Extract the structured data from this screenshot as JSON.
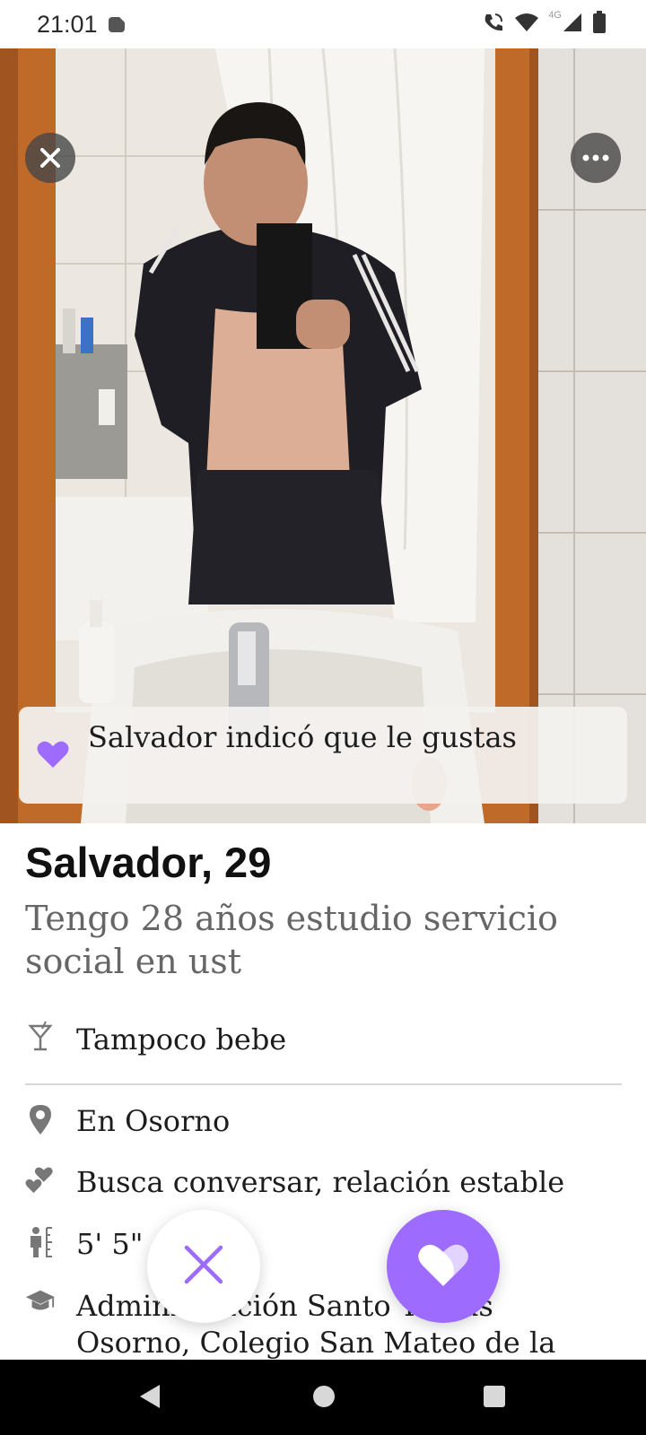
{
  "status_bar": {
    "time": "21:01",
    "network": "4G",
    "icons": [
      "notification-icon",
      "wifi-calling-icon",
      "wifi-icon",
      "cell-signal-icon",
      "battery-icon"
    ]
  },
  "photo": {
    "liked_banner": "Salvador indicó que le gustas",
    "icons": [
      "close-icon",
      "more-icon",
      "heart-icon"
    ]
  },
  "profile": {
    "name_age": "Salvador, 29",
    "bio": "Tengo 28 años estudio servicio social en ust",
    "drinking": "Tampoco bebe",
    "location": "En Osorno",
    "looking_for": "Busca conversar, relación estable",
    "height": "5' 5\"",
    "education": "Administración Santo Tomás Osorno, Colegio San Mateo de la Compañía de Jesús"
  },
  "actions": {
    "icons": [
      "pass-x-icon",
      "like-heart-icon"
    ]
  },
  "nav": {
    "icons": [
      "back-icon",
      "home-icon",
      "recents-icon"
    ]
  },
  "colors": {
    "accent": "#9e6bff",
    "text_primary": "#111111",
    "text_secondary": "#666666"
  }
}
